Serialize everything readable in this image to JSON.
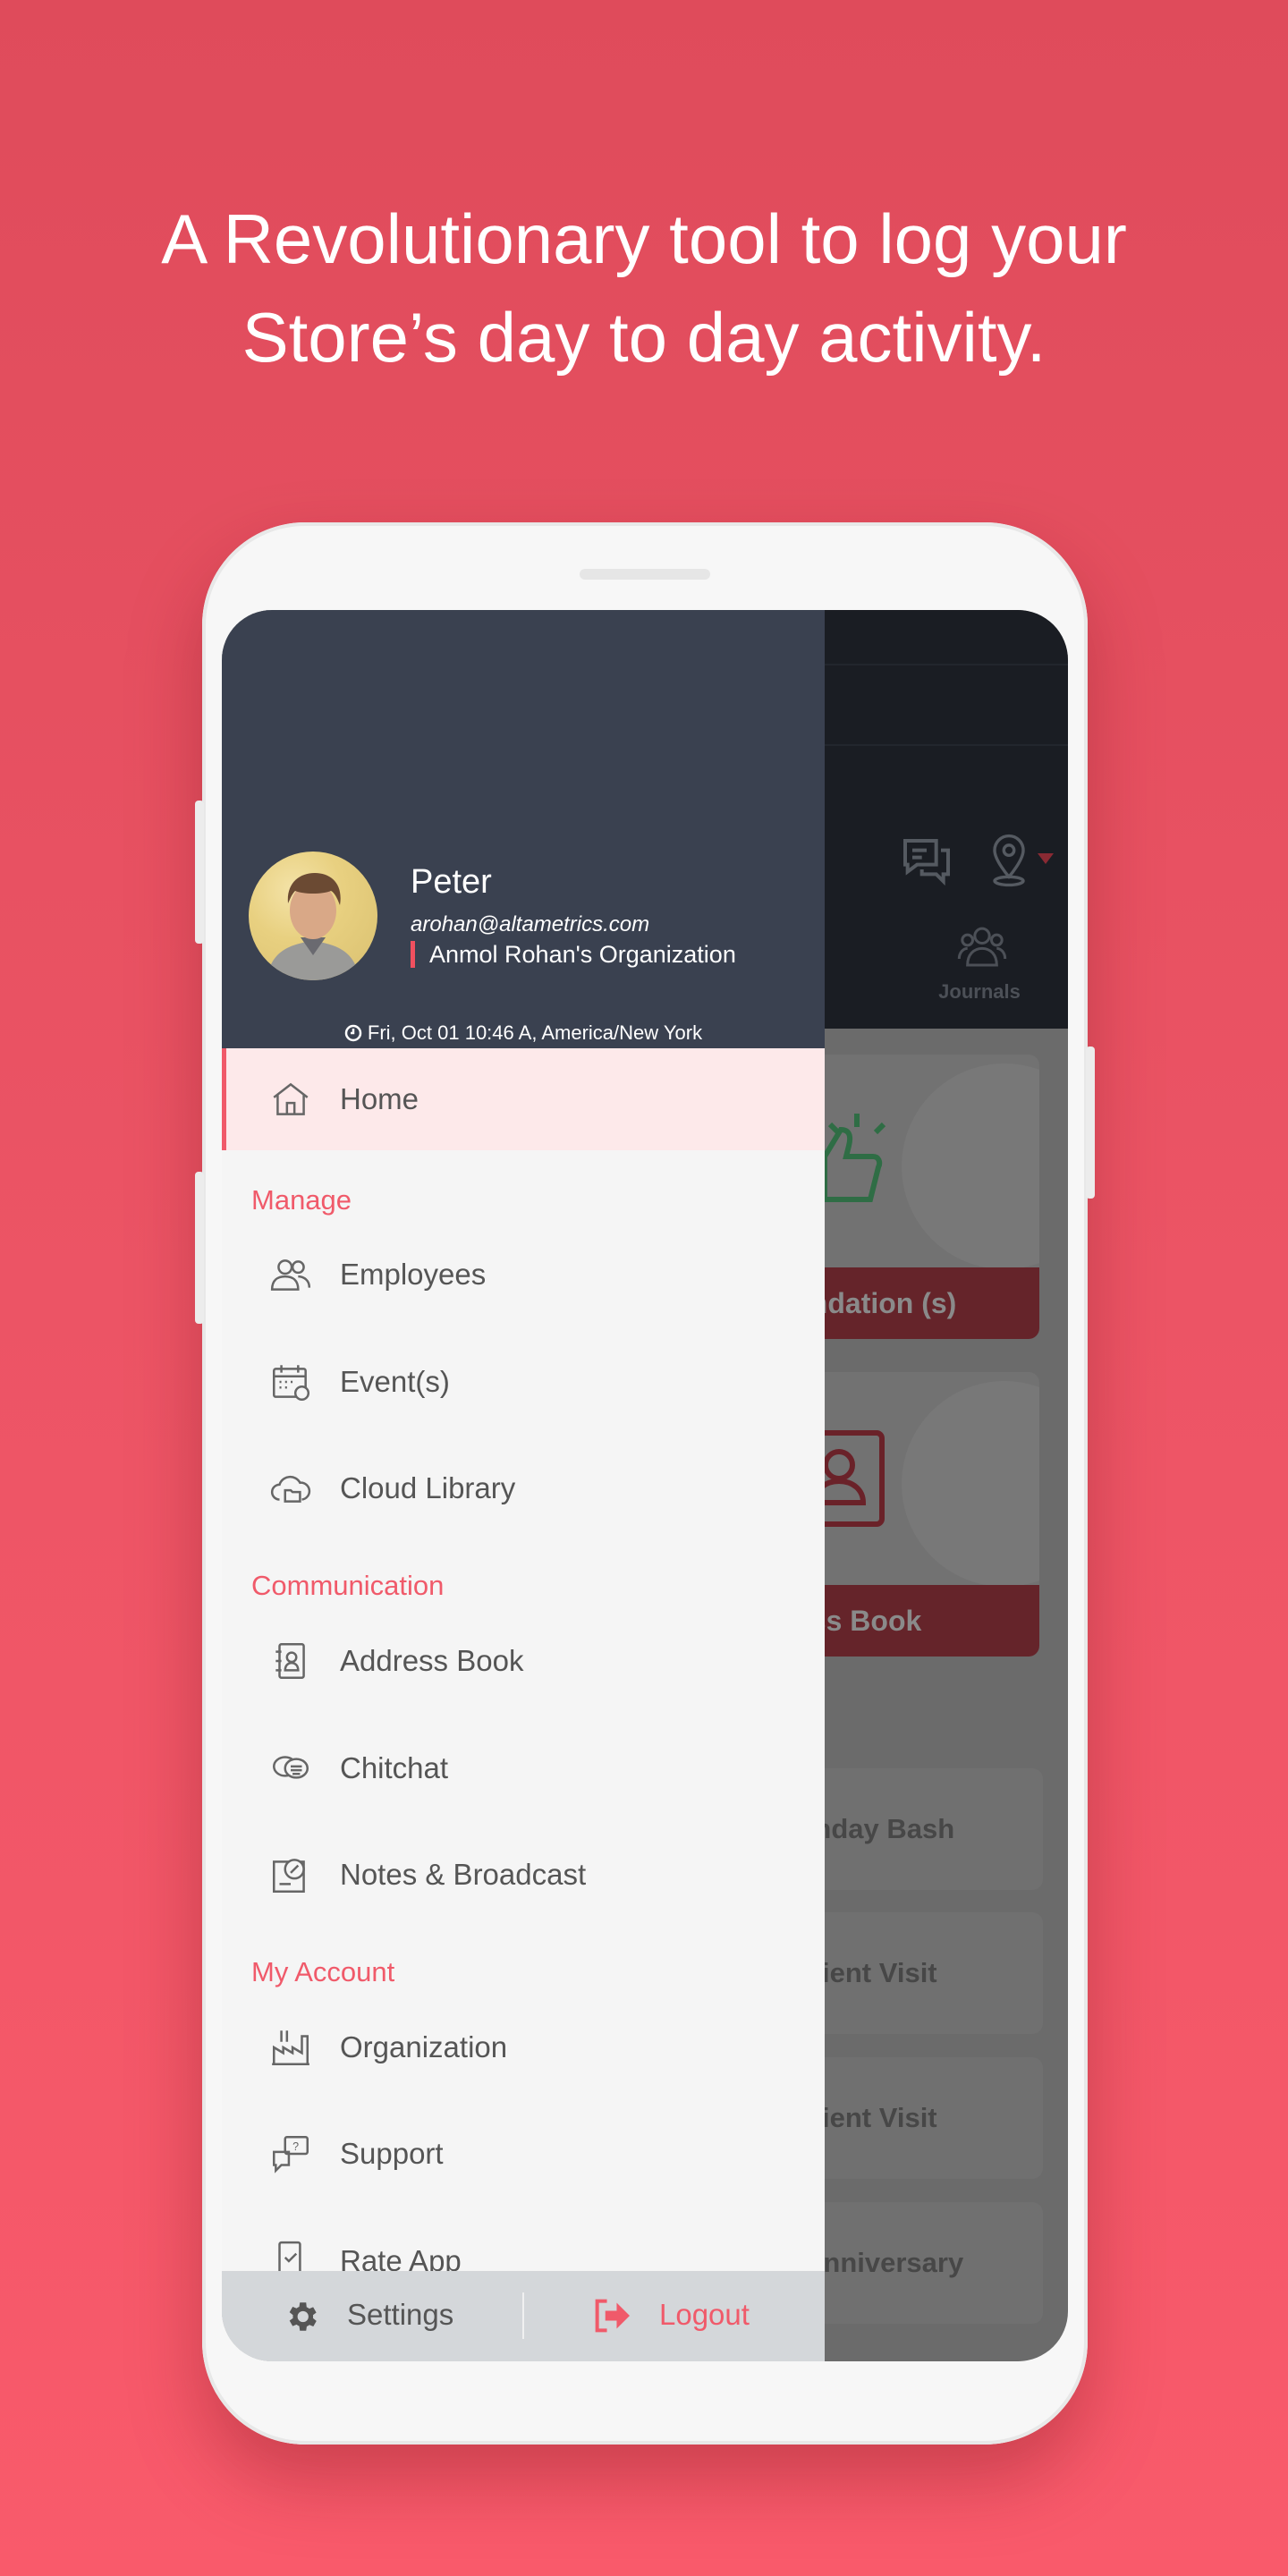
{
  "headline": [
    "A Revolutionary tool to log your",
    "Store’s day to day activity."
  ],
  "colors": {
    "accent": "#f05a6a",
    "drawer_header": "#3a4150",
    "active_row": "#fde9ea"
  },
  "profile": {
    "name": "Peter",
    "email": "arohan@altametrics.com",
    "organization": "Anmol Rohan's Organization",
    "datetime": "Fri, Oct 01 10:46 A, America/New York"
  },
  "menu": {
    "home": {
      "label": "Home",
      "icon": "home-icon"
    },
    "sections": [
      {
        "title": "Manage",
        "items": [
          {
            "label": "Employees",
            "icon": "employees-icon"
          },
          {
            "label": "Event(s)",
            "icon": "calendar-icon"
          },
          {
            "label": "Cloud Library",
            "icon": "cloud-folder-icon"
          }
        ]
      },
      {
        "title": "Communication",
        "items": [
          {
            "label": "Address Book",
            "icon": "address-book-icon"
          },
          {
            "label": "Chitchat",
            "icon": "chat-icon"
          },
          {
            "label": "Notes & Broadcast",
            "icon": "broadcast-icon"
          }
        ]
      },
      {
        "title": "My Account",
        "items": [
          {
            "label": "Organization",
            "icon": "factory-icon"
          },
          {
            "label": "Support",
            "icon": "support-icon"
          },
          {
            "label": "Rate App",
            "icon": "rate-app-icon"
          }
        ]
      }
    ]
  },
  "bottom": {
    "settings": "Settings",
    "logout": "Logout"
  },
  "background_app": {
    "journals": "Journals",
    "cards": [
      "endation (s)",
      "ess Book"
    ],
    "list": [
      "rthday Bash",
      "Client Visit",
      "Client Visit",
      "Anniversary"
    ]
  }
}
